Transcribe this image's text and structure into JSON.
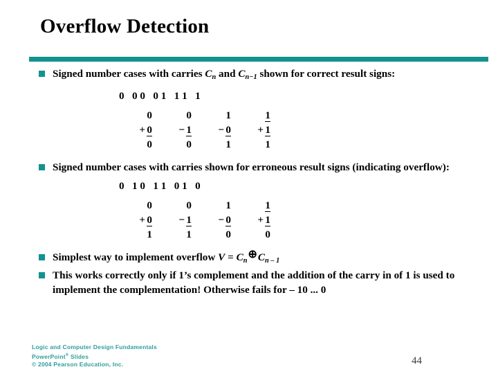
{
  "slide": {
    "title": "Overflow Detection",
    "page_number": "44",
    "accent_color": "#13928f",
    "bullet_glyph": "square-bullet"
  },
  "bullets": [
    {
      "id": "correct-signs",
      "text_parts": {
        "pre": "Signed number cases with carries ",
        "var1": "C",
        "var1_sub": "n",
        "mid": " and ",
        "var2": "C",
        "var2_sub": "n−1",
        "post": " shown for correct result signs:"
      }
    },
    {
      "id": "erroneous-signs",
      "text": "Signed number cases with carries shown for erroneous result signs (indicating overflow):"
    },
    {
      "id": "simplest-way",
      "text_parts": {
        "pre": "Simplest way to implement overflow ",
        "v": "V",
        "eq": " = ",
        "var1": "C",
        "var1_sub": "n",
        "op": "⊕",
        "var2": "C",
        "var2_sub": "n – 1"
      }
    },
    {
      "id": "works-correctly",
      "text": "This works correctly only if 1’s complement and the addition of the carry in of 1 is used to implement the complementation! Otherwise fails for – 10 ... 0"
    }
  ],
  "arithmetic_blocks": [
    {
      "id": "correct-result-block",
      "carry_row": "0   0 0   0 1   1 1   1",
      "columns": [
        {
          "operand1": "0",
          "sign": "+",
          "operand2": "0",
          "result": "0"
        },
        {
          "operand1": "0",
          "sign": "−",
          "operand2": "1",
          "result": "0"
        },
        {
          "operand1": "1",
          "sign": "−",
          "operand2": "0",
          "result": "1"
        },
        {
          "operand1": "1",
          "sign": "+",
          "operand2": "1",
          "result": "1"
        }
      ]
    },
    {
      "id": "overflow-result-block",
      "carry_row": "0   1 0   1 1   0 1   0",
      "columns": [
        {
          "operand1": "0",
          "sign": "+",
          "operand2": "0",
          "result": "1"
        },
        {
          "operand1": "0",
          "sign": "−",
          "operand2": "1",
          "result": "1"
        },
        {
          "operand1": "1",
          "sign": "−",
          "operand2": "0",
          "result": "0"
        },
        {
          "operand1": "1",
          "sign": "+",
          "operand2": "1",
          "result": "0"
        }
      ]
    }
  ],
  "footer": {
    "line1": "Logic and Computer Design Fundamentals",
    "line2_pre": "PowerPoint",
    "line2_sup": "®",
    "line2_post": " Slides",
    "line3": "© 2004 Pearson Education, Inc."
  }
}
